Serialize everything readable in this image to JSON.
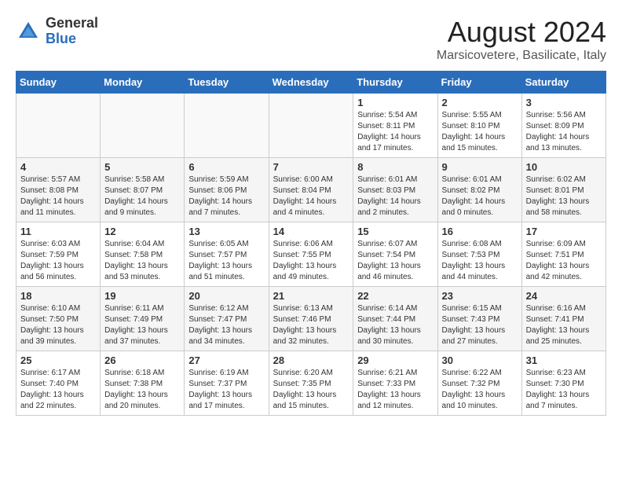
{
  "logo": {
    "text_general": "General",
    "text_blue": "Blue"
  },
  "title": "August 2024",
  "subtitle": "Marsicovetere, Basilicate, Italy",
  "days_of_week": [
    "Sunday",
    "Monday",
    "Tuesday",
    "Wednesday",
    "Thursday",
    "Friday",
    "Saturday"
  ],
  "weeks": [
    [
      {
        "day": "",
        "info": ""
      },
      {
        "day": "",
        "info": ""
      },
      {
        "day": "",
        "info": ""
      },
      {
        "day": "",
        "info": ""
      },
      {
        "day": "1",
        "info": "Sunrise: 5:54 AM\nSunset: 8:11 PM\nDaylight: 14 hours\nand 17 minutes."
      },
      {
        "day": "2",
        "info": "Sunrise: 5:55 AM\nSunset: 8:10 PM\nDaylight: 14 hours\nand 15 minutes."
      },
      {
        "day": "3",
        "info": "Sunrise: 5:56 AM\nSunset: 8:09 PM\nDaylight: 14 hours\nand 13 minutes."
      }
    ],
    [
      {
        "day": "4",
        "info": "Sunrise: 5:57 AM\nSunset: 8:08 PM\nDaylight: 14 hours\nand 11 minutes."
      },
      {
        "day": "5",
        "info": "Sunrise: 5:58 AM\nSunset: 8:07 PM\nDaylight: 14 hours\nand 9 minutes."
      },
      {
        "day": "6",
        "info": "Sunrise: 5:59 AM\nSunset: 8:06 PM\nDaylight: 14 hours\nand 7 minutes."
      },
      {
        "day": "7",
        "info": "Sunrise: 6:00 AM\nSunset: 8:04 PM\nDaylight: 14 hours\nand 4 minutes."
      },
      {
        "day": "8",
        "info": "Sunrise: 6:01 AM\nSunset: 8:03 PM\nDaylight: 14 hours\nand 2 minutes."
      },
      {
        "day": "9",
        "info": "Sunrise: 6:01 AM\nSunset: 8:02 PM\nDaylight: 14 hours\nand 0 minutes."
      },
      {
        "day": "10",
        "info": "Sunrise: 6:02 AM\nSunset: 8:01 PM\nDaylight: 13 hours\nand 58 minutes."
      }
    ],
    [
      {
        "day": "11",
        "info": "Sunrise: 6:03 AM\nSunset: 7:59 PM\nDaylight: 13 hours\nand 56 minutes."
      },
      {
        "day": "12",
        "info": "Sunrise: 6:04 AM\nSunset: 7:58 PM\nDaylight: 13 hours\nand 53 minutes."
      },
      {
        "day": "13",
        "info": "Sunrise: 6:05 AM\nSunset: 7:57 PM\nDaylight: 13 hours\nand 51 minutes."
      },
      {
        "day": "14",
        "info": "Sunrise: 6:06 AM\nSunset: 7:55 PM\nDaylight: 13 hours\nand 49 minutes."
      },
      {
        "day": "15",
        "info": "Sunrise: 6:07 AM\nSunset: 7:54 PM\nDaylight: 13 hours\nand 46 minutes."
      },
      {
        "day": "16",
        "info": "Sunrise: 6:08 AM\nSunset: 7:53 PM\nDaylight: 13 hours\nand 44 minutes."
      },
      {
        "day": "17",
        "info": "Sunrise: 6:09 AM\nSunset: 7:51 PM\nDaylight: 13 hours\nand 42 minutes."
      }
    ],
    [
      {
        "day": "18",
        "info": "Sunrise: 6:10 AM\nSunset: 7:50 PM\nDaylight: 13 hours\nand 39 minutes."
      },
      {
        "day": "19",
        "info": "Sunrise: 6:11 AM\nSunset: 7:49 PM\nDaylight: 13 hours\nand 37 minutes."
      },
      {
        "day": "20",
        "info": "Sunrise: 6:12 AM\nSunset: 7:47 PM\nDaylight: 13 hours\nand 34 minutes."
      },
      {
        "day": "21",
        "info": "Sunrise: 6:13 AM\nSunset: 7:46 PM\nDaylight: 13 hours\nand 32 minutes."
      },
      {
        "day": "22",
        "info": "Sunrise: 6:14 AM\nSunset: 7:44 PM\nDaylight: 13 hours\nand 30 minutes."
      },
      {
        "day": "23",
        "info": "Sunrise: 6:15 AM\nSunset: 7:43 PM\nDaylight: 13 hours\nand 27 minutes."
      },
      {
        "day": "24",
        "info": "Sunrise: 6:16 AM\nSunset: 7:41 PM\nDaylight: 13 hours\nand 25 minutes."
      }
    ],
    [
      {
        "day": "25",
        "info": "Sunrise: 6:17 AM\nSunset: 7:40 PM\nDaylight: 13 hours\nand 22 minutes."
      },
      {
        "day": "26",
        "info": "Sunrise: 6:18 AM\nSunset: 7:38 PM\nDaylight: 13 hours\nand 20 minutes."
      },
      {
        "day": "27",
        "info": "Sunrise: 6:19 AM\nSunset: 7:37 PM\nDaylight: 13 hours\nand 17 minutes."
      },
      {
        "day": "28",
        "info": "Sunrise: 6:20 AM\nSunset: 7:35 PM\nDaylight: 13 hours\nand 15 minutes."
      },
      {
        "day": "29",
        "info": "Sunrise: 6:21 AM\nSunset: 7:33 PM\nDaylight: 13 hours\nand 12 minutes."
      },
      {
        "day": "30",
        "info": "Sunrise: 6:22 AM\nSunset: 7:32 PM\nDaylight: 13 hours\nand 10 minutes."
      },
      {
        "day": "31",
        "info": "Sunrise: 6:23 AM\nSunset: 7:30 PM\nDaylight: 13 hours\nand 7 minutes."
      }
    ]
  ]
}
